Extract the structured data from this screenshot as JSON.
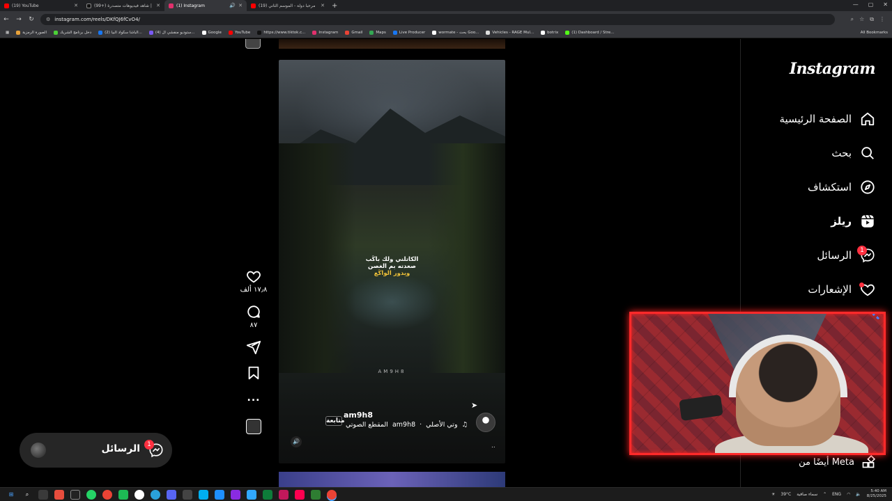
{
  "browser": {
    "tabs": [
      {
        "title": "(19) YouTube",
        "color": "#ff0000",
        "active": false
      },
      {
        "title": "(99+) شاهد فيديوهات متصدرة |",
        "color": "#111111",
        "active": false
      },
      {
        "title": "(1) Instagram",
        "color": "#e1306c",
        "active": true
      },
      {
        "title": "(19) مرحبا دولة - الموسم الثاني",
        "color": "#ff0000",
        "active": false
      }
    ],
    "new_tab": "+",
    "url": "instagram.com/reels/DKfQJ6fCvO4/",
    "bookmarks": [
      {
        "label": "الصورة الرمزية",
        "color": "#e8a23a"
      },
      {
        "label": "دخل برنامج الشريك",
        "color": "#4cd137"
      },
      {
        "label": "(2) الباشا سكواد البيا...",
        "color": "#1877f2"
      },
      {
        "label": "(4) ستوديو منفشي ال...",
        "color": "#7a5af5"
      },
      {
        "label": "Google",
        "color": "#ffffff"
      },
      {
        "label": "YouTube",
        "color": "#ff0000"
      },
      {
        "label": "https://www.tiktok.c...",
        "color": "#111111"
      },
      {
        "label": "Instagram",
        "color": "#e1306c"
      },
      {
        "label": "Gmail",
        "color": "#ea4335"
      },
      {
        "label": "Maps",
        "color": "#34a853"
      },
      {
        "label": "Live Producer",
        "color": "#1877f2"
      },
      {
        "label": "wormate - بحث Goo...",
        "color": "#ffffff"
      },
      {
        "label": "Vehicles - RAGE Mul...",
        "color": "#dddddd"
      },
      {
        "label": "botrix",
        "color": "#ffffff"
      },
      {
        "label": "(1) Dashboard / Stre...",
        "color": "#53fc18"
      }
    ],
    "all_bookmarks": "All Bookmarks"
  },
  "reel": {
    "lyrics": [
      "الكاتلني ولك باكَب",
      "صعدته بم الغصن",
      "ويدور الواكَع"
    ],
    "watermark": "AM9H8",
    "author": "am9h8",
    "follow": "متابعة",
    "audio_original": "وتي الأصلي",
    "audio_author": "am9h8",
    "audio_clip": "المقطع الصوتي",
    "more_dots": ".."
  },
  "actions": {
    "likes": "١٧٫٨ ألف",
    "comments": "٨٧",
    "more": "..."
  },
  "sidebar": {
    "logo": "Instagram",
    "items": [
      {
        "label": "الصفحة الرئيسية",
        "icon": "home-icon"
      },
      {
        "label": "بحث",
        "icon": "search-icon"
      },
      {
        "label": "استكشاف",
        "icon": "compass-icon"
      },
      {
        "label": "ريلز",
        "icon": "reels-icon"
      },
      {
        "label": "الرسائل",
        "icon": "messenger-icon",
        "badge": "1"
      },
      {
        "label": "الإشعارات",
        "icon": "heart-icon"
      }
    ],
    "also_from_meta": "أيضًا من Meta"
  },
  "messages_pill": {
    "label": "الرسائل",
    "badge": "1"
  },
  "taskbar": {
    "weather": "39°C",
    "weather_desc": "سماء صافية",
    "lang": "ENG",
    "time": "5:40 AM",
    "date": "8/25/2025"
  },
  "colors": {
    "accent_red": "#ff3040",
    "cam_border": "#ff2a2a"
  }
}
